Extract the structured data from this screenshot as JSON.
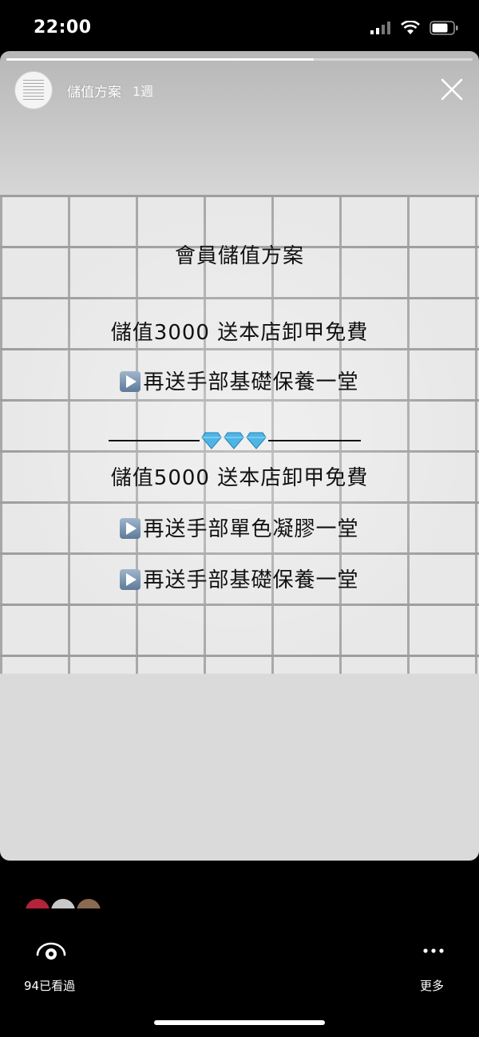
{
  "status_bar": {
    "time": "22:00"
  },
  "story": {
    "title": "儲值方案",
    "time_ago": "1週",
    "progress": 0.66,
    "lines": [
      "會員儲值方案",
      "儲值3000 送本店卸甲免費",
      "再送手部基礎保養一堂",
      "儲值5000 送本店卸甲免費",
      "再送手部單色凝膠一堂",
      "再送手部基礎保養一堂"
    ]
  },
  "footer": {
    "views_label": "94已看過",
    "more_label": "更多"
  },
  "colors": {
    "background": "#000000",
    "story_card": "#dadada",
    "text": "#111111"
  },
  "icons": [
    "signal-icon",
    "wifi-icon",
    "battery-icon",
    "close-icon",
    "play-button-icon",
    "diamond-icon",
    "eye-icon",
    "more-icon"
  ]
}
